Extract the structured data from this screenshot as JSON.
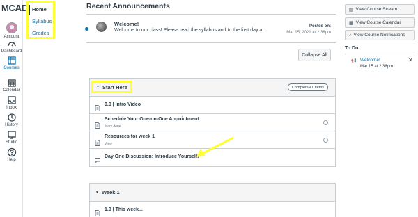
{
  "global_nav": {
    "logo": "MCAD",
    "items": [
      {
        "label": "Account",
        "icon": "account-avatar"
      },
      {
        "label": "Dashboard",
        "icon": "dashboard-icon"
      },
      {
        "label": "Courses",
        "icon": "courses-icon",
        "active": true
      },
      {
        "label": "Calendar",
        "icon": "calendar-icon"
      },
      {
        "label": "Inbox",
        "icon": "inbox-icon"
      },
      {
        "label": "History",
        "icon": "history-icon"
      },
      {
        "label": "Studio",
        "icon": "studio-icon"
      },
      {
        "label": "Help",
        "icon": "help-icon"
      }
    ]
  },
  "course_nav": {
    "items": [
      {
        "label": "Home",
        "current": true
      },
      {
        "label": "Syllabus"
      },
      {
        "label": "Grades"
      }
    ]
  },
  "announcements": {
    "heading": "Recent Announcements",
    "item": {
      "title": "Welcome!",
      "message": "Welcome to our class! Please read the syllabus and to the first day a...",
      "posted_label": "Posted on:",
      "date": "Mar 15, 2021 at 2:38pm"
    },
    "collapse_label": "Collapse All"
  },
  "modules": [
    {
      "name": "Start Here",
      "complete_label": "Complete All Items",
      "items": [
        {
          "title": "0.0 | Intro Video",
          "icon": "page-icon"
        },
        {
          "title": "Schedule Your One-on-One Appointment",
          "sub": "Mark done",
          "icon": "page-icon"
        },
        {
          "title": "Resources for week 1",
          "sub": "View",
          "icon": "page-icon"
        },
        {
          "title": "Day One Discussion: Introduce Yourself!",
          "icon": "discussion-icon"
        }
      ]
    },
    {
      "name": "Week 1",
      "items": [
        {
          "title": "1.0 | This week...",
          "icon": "page-icon"
        }
      ]
    }
  ],
  "sidebar": {
    "buttons": [
      {
        "label": "View Course Stream",
        "icon": "stream-icon"
      },
      {
        "label": "View Course Calendar",
        "icon": "calendar-icon"
      },
      {
        "label": "View Course Notifications",
        "icon": "bell-icon"
      }
    ],
    "todo": {
      "heading": "To Do",
      "title": "Welcome!",
      "date": "Mar 15 at 2:38pm"
    }
  },
  "colors": {
    "highlight": "#ffff33",
    "link": "#0374b5",
    "text": "#2d3b45"
  }
}
